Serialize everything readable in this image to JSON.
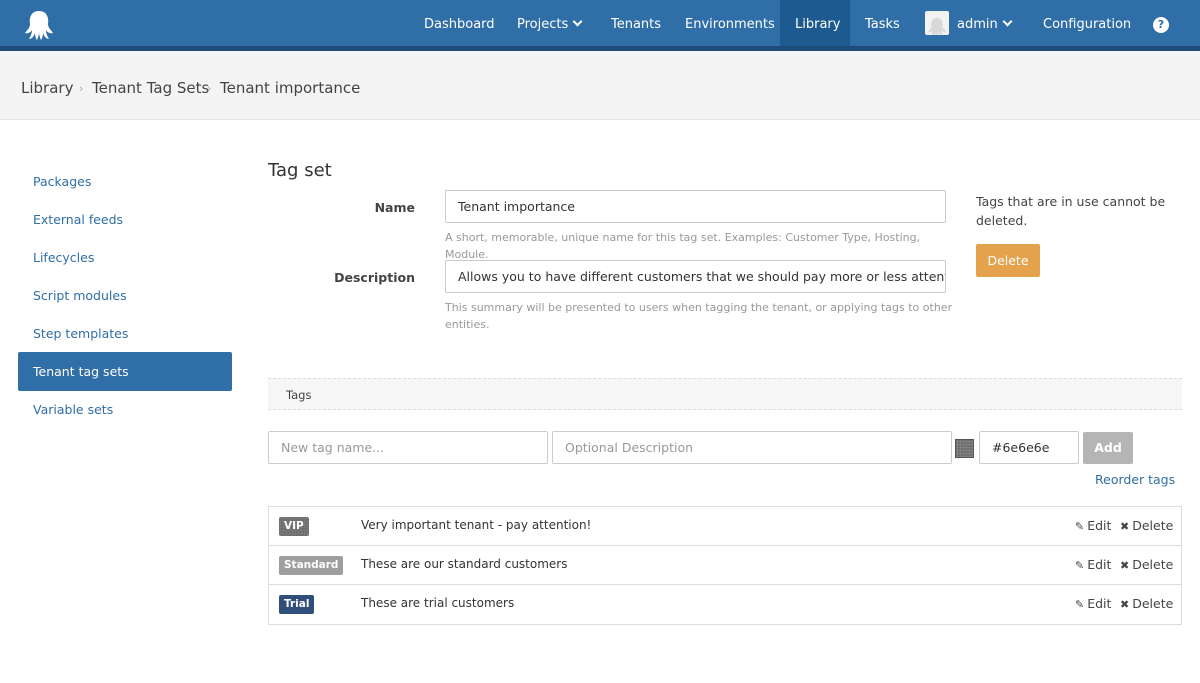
{
  "nav": {
    "items": [
      {
        "label": "Dashboard"
      },
      {
        "label": "Projects"
      },
      {
        "label": "Tenants"
      },
      {
        "label": "Environments"
      },
      {
        "label": "Library"
      },
      {
        "label": "Tasks"
      },
      {
        "label": "admin"
      },
      {
        "label": "Configuration"
      }
    ],
    "active": "Library",
    "help_glyph": "?"
  },
  "breadcrumb": [
    "Library",
    "Tenant Tag Sets",
    "Tenant importance"
  ],
  "sidebar": {
    "items": [
      {
        "label": "Packages"
      },
      {
        "label": "External feeds"
      },
      {
        "label": "Lifecycles"
      },
      {
        "label": "Script modules"
      },
      {
        "label": "Step templates"
      },
      {
        "label": "Tenant tag sets"
      },
      {
        "label": "Variable sets"
      }
    ],
    "active": "Tenant tag sets"
  },
  "form": {
    "title": "Tag set",
    "name_label": "Name",
    "name_value": "Tenant importance",
    "name_hint": "A short, memorable, unique name for this tag set. Examples: Customer Type, Hosting, Module.",
    "description_label": "Description",
    "description_value": "Allows you to have different customers that we should pay more or less attention to",
    "description_hint": "This summary will be presented to users when tagging the tenant, or applying tags to other entities.",
    "side_note": "Tags that are in use cannot be deleted.",
    "delete_label": "Delete"
  },
  "tags": {
    "header": "Tags",
    "new_tag_placeholder": "New tag name...",
    "description_placeholder": "Optional Description",
    "color_value": "#6e6e6e",
    "add_label": "Add",
    "reorder_label": "Reorder tags",
    "edit_label": "Edit",
    "delete_label": "Delete",
    "rows": [
      {
        "name": "VIP",
        "description": "Very important tenant - pay attention!",
        "color": "#6e6e6e"
      },
      {
        "name": "Standard",
        "description": "These are our standard customers",
        "color": "#9e9e9e"
      },
      {
        "name": "Trial",
        "description": "These are trial customers",
        "color": "#2f4f7a"
      }
    ]
  },
  "colors": {
    "brand": "#2f6ea6",
    "delete_button": "#e5a24d",
    "add_button": "#b5b5b5"
  }
}
